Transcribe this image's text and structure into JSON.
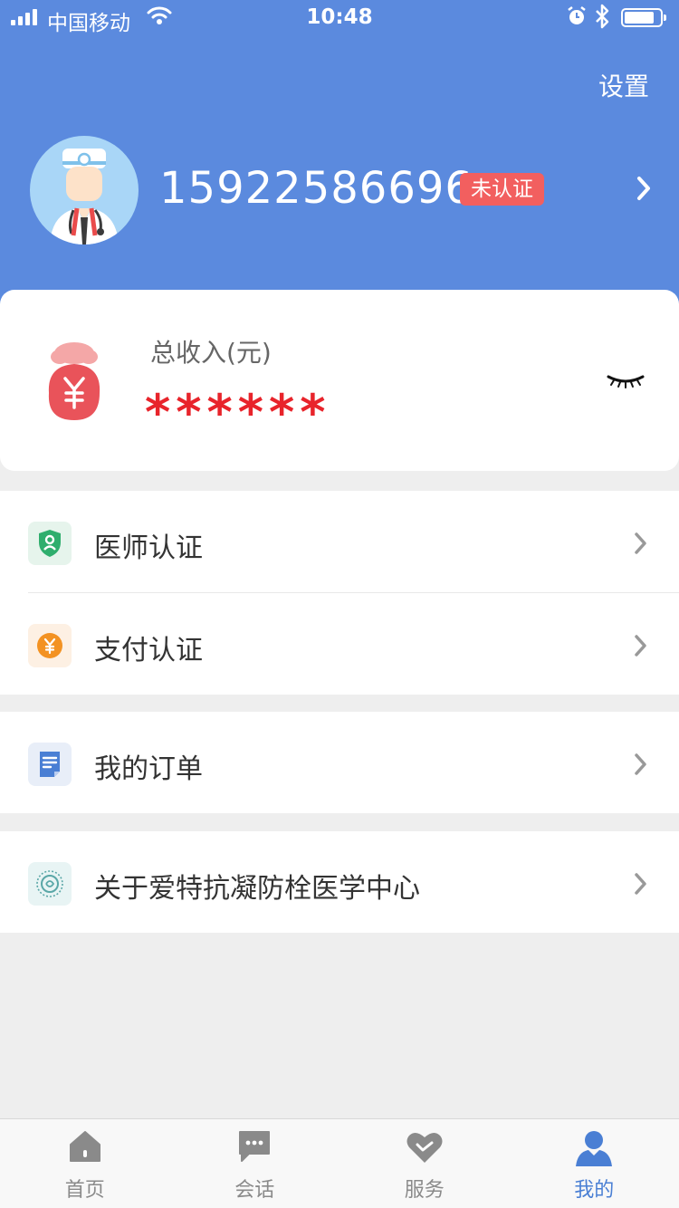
{
  "status_bar": {
    "carrier": "中国移动",
    "time": "10:48",
    "battery_level": 0.85
  },
  "header": {
    "settings_label": "设置",
    "phone": "15922586696",
    "verify_badge": "未认证"
  },
  "income": {
    "label": "总收入(元)",
    "masked_value": "******"
  },
  "menu": {
    "doctor_cert": "医师认证",
    "payment_cert": "支付认证",
    "my_orders": "我的订单",
    "about": "关于爱特抗凝防栓医学中心"
  },
  "tabbar": {
    "home": "首页",
    "chat": "会话",
    "service": "服务",
    "mine": "我的",
    "active_tab": "mine"
  },
  "colors": {
    "header_blue": "#5b8ade",
    "badge_red": "#f25f5f",
    "masked_red": "#e8242b",
    "tab_active": "#4a7fd4",
    "tab_inactive": "#8a8a8a"
  }
}
